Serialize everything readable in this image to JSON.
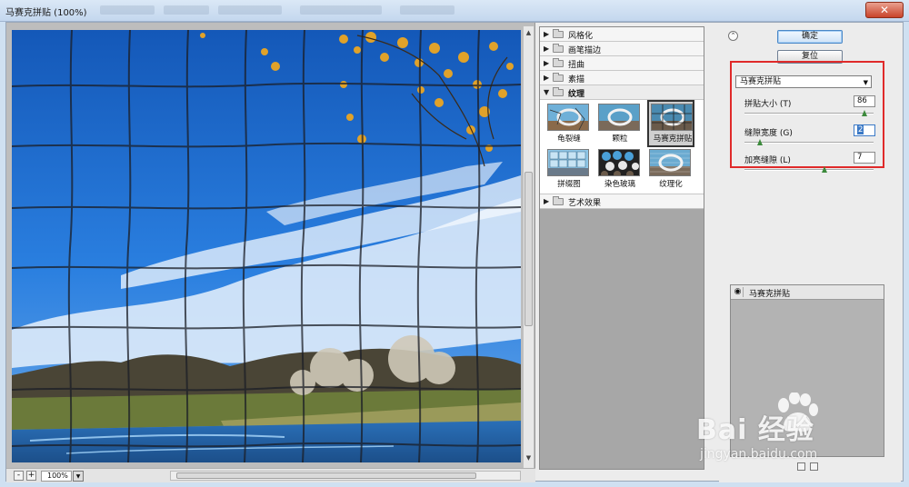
{
  "window": {
    "title": "马赛克拼贴 (100%)",
    "close_icon": "close-icon"
  },
  "preview": {
    "zoom": "100%",
    "zoom_in_label": "+",
    "zoom_out_label": "-"
  },
  "gallery": {
    "categories": [
      {
        "label": "风格化",
        "open": false
      },
      {
        "label": "画笔描边",
        "open": false
      },
      {
        "label": "扭曲",
        "open": false
      },
      {
        "label": "素描",
        "open": false
      },
      {
        "label": "纹理",
        "open": true
      }
    ],
    "texture_filters": [
      {
        "label": "龟裂缝",
        "selected": false
      },
      {
        "label": "颗粒",
        "selected": false
      },
      {
        "label": "马赛克拼贴",
        "selected": true
      },
      {
        "label": "拼缀图",
        "selected": false
      },
      {
        "label": "染色玻璃",
        "selected": false
      },
      {
        "label": "纹理化",
        "selected": false
      }
    ],
    "after_category": {
      "label": "艺术效果",
      "open": false
    }
  },
  "controls": {
    "ok_label": "确定",
    "reset_label": "复位",
    "filter_select": "马赛克拼贴",
    "params": [
      {
        "label": "拼贴大小 (T)",
        "value": "86",
        "slider": 0.93
      },
      {
        "label": "缝隙宽度 (G)",
        "value": "2",
        "slider": 0.12
      },
      {
        "label": "加亮缝隙 (L)",
        "value": "7",
        "slider": 0.62
      }
    ]
  },
  "layers": {
    "items": [
      {
        "name": "马赛克拼贴",
        "visible": true
      }
    ]
  },
  "watermark": {
    "brand": "Bai  经验",
    "site": "jingyan.baidu.com"
  },
  "colors": {
    "sky": "#1a6fd0",
    "highlight": "#e02a2a",
    "accent": "#3b79c6"
  }
}
